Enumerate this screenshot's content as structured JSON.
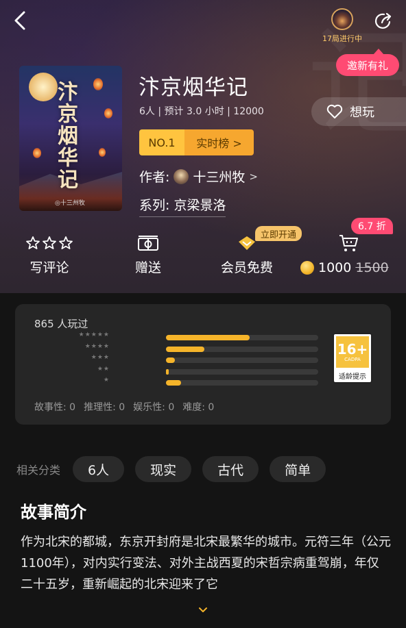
{
  "header": {
    "game_status": "17局进行中",
    "invite": "邀新有礼",
    "want_play": "想玩"
  },
  "book": {
    "title": "汴京烟华记",
    "cover_title": "汴京烟华记",
    "meta": "6人 | 预计 3.0 小时 | 12000",
    "rank_no": "NO.1",
    "rank_list": "实时榜 >",
    "author_label": "作者:",
    "author_name": "十三州牧",
    "author_arrow": ">",
    "series": "系列: 京梁景洛",
    "cover_author": "◎十三州牧"
  },
  "actions": {
    "review": "写评论",
    "gift": "赠送",
    "member_free": "会员免费",
    "open_now": "立即开通",
    "discount": "6.7 折",
    "price": "1000",
    "price_old": "1500"
  },
  "stats": {
    "played": "865 人玩过",
    "ratings": [
      {
        "stars": "★★★★★",
        "fraction": 0.55
      },
      {
        "stars": "★★★★",
        "fraction": 0.25
      },
      {
        "stars": "★★★",
        "fraction": 0.06
      },
      {
        "stars": "★★",
        "fraction": 0.02
      },
      {
        "stars": "★",
        "fraction": 0.1
      }
    ],
    "age_num": "16+",
    "age_org": "CADPA",
    "age_hint": "适龄提示",
    "attributes": [
      "故事性: 0",
      "推理性: 0",
      "娱乐性: 0",
      "难度: 0"
    ]
  },
  "categories": {
    "label": "相关分类",
    "chips": [
      "6人",
      "现实",
      "古代",
      "简单"
    ]
  },
  "synopsis": {
    "title": "故事简介",
    "text": "作为北宋的都城，东京开封府是北宋最繁华的城市。元符三年（公元1100年），对内实行变法、对外主战西夏的宋哲宗病重驾崩，年仅二十五岁，重新崛起的北宋迎来了它"
  },
  "colors": {
    "accent_gold": "#f5b42a",
    "accent_pink": "#ff4b73"
  }
}
